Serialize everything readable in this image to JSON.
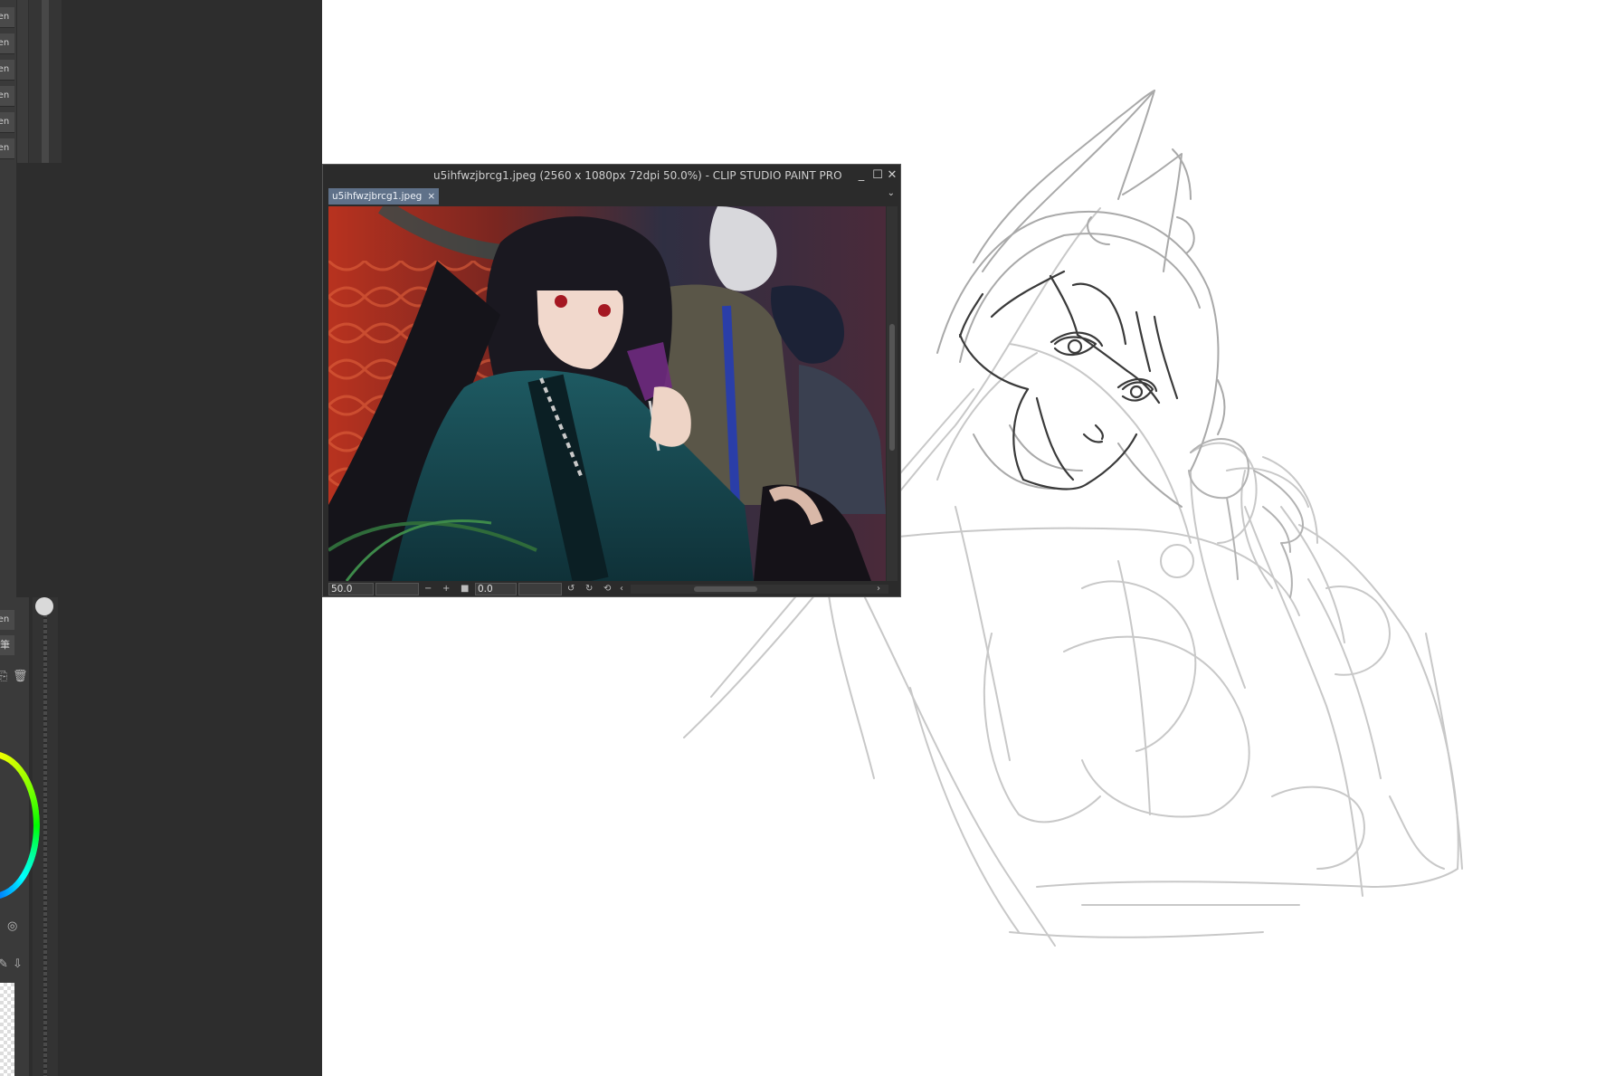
{
  "left_panel": {
    "tool_labels": [
      "Pen",
      "Pen",
      "Pen",
      "Pen",
      "Pen",
      "Pen"
    ],
    "lower_labels": [
      "Pen",
      "筆"
    ]
  },
  "subview": {
    "window_title": "u5ihfwzjbrcg1.jpeg (2560 x 1080px 72dpi 50.0%)  - CLIP STUDIO PAINT PRO",
    "tab_label": "u5ihfwzjbrcg1.jpeg",
    "tab_close": "×",
    "minimize_icon": "_",
    "maximize_icon": "☐",
    "close_icon": "✕",
    "zoom_value": "50.0",
    "rotation_value": "0.0"
  }
}
